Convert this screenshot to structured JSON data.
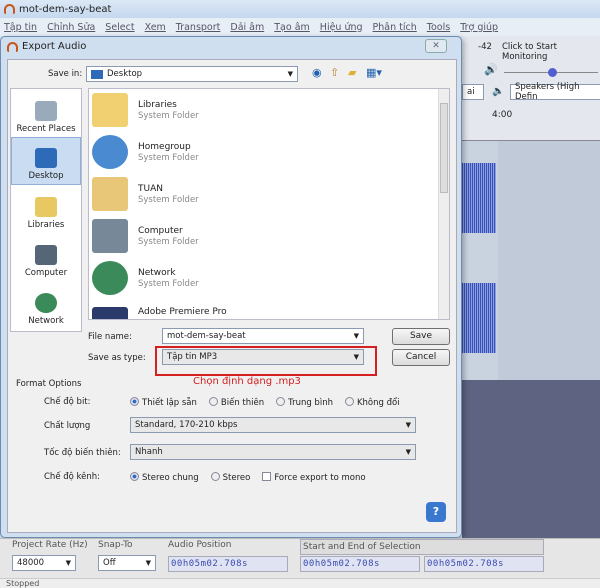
{
  "app": {
    "title": "mot-dem-say-beat",
    "menu": [
      "Tập tin",
      "Chỉnh Sửa",
      "Select",
      "Xem",
      "Transport",
      "Dải âm",
      "Tạo âm",
      "Hiệu ứng",
      "Phân tích",
      "Tools",
      "Trợ giúp"
    ]
  },
  "right": {
    "meter_value": "-42",
    "monitor": "Click to Start Monitoring",
    "device_partial": "ai",
    "speakers": "Speakers (High Defin",
    "time_mark": "4:00"
  },
  "dialog": {
    "title": "Export Audio",
    "save_in_label": "Save in:",
    "save_in_value": "Desktop",
    "places": [
      "Recent Places",
      "Desktop",
      "Libraries",
      "Computer",
      "Network"
    ],
    "files": [
      {
        "name": "Libraries",
        "type": "System Folder"
      },
      {
        "name": "Homegroup",
        "type": "System Folder"
      },
      {
        "name": "TUAN",
        "type": "System Folder"
      },
      {
        "name": "Computer",
        "type": "System Folder"
      },
      {
        "name": "Network",
        "type": "System Folder"
      },
      {
        "name": "Adobe Premiere Pro",
        "type": ""
      }
    ],
    "file_name_label": "File name:",
    "file_name_value": "mot-dem-say-beat",
    "save_type_label": "Save as type:",
    "save_type_value": "Tập tin MP3",
    "save": "Save",
    "cancel": "Cancel",
    "annotation": "Chọn định dạng .mp3",
    "annotation_color": "#d42020",
    "format_options": "Format Options",
    "bit_mode_label": "Chế độ bit:",
    "bit_modes": [
      "Thiết lập sẵn",
      "Biến thiên",
      "Trung bình",
      "Không đổi"
    ],
    "quality_label": "Chất lượng",
    "quality_value": "Standard, 170-210 kbps",
    "var_speed_label": "Tốc độ biến thiên:",
    "var_speed_value": "Nhanh",
    "channel_label": "Chế độ kênh:",
    "channel_modes": [
      "Stereo chung",
      "Stereo"
    ],
    "force_mono": "Force export to mono"
  },
  "bottom": {
    "rate_label": "Project Rate (Hz)",
    "rate": "48000",
    "snap_label": "Snap-To",
    "snap": "Off",
    "pos_label": "Audio Position",
    "pos": "00h05m02.708s",
    "sel_label": "Start and End of Selection",
    "sel_start": "00h05m02.708s",
    "sel_end": "00h05m02.708s",
    "status": "Stopped"
  }
}
